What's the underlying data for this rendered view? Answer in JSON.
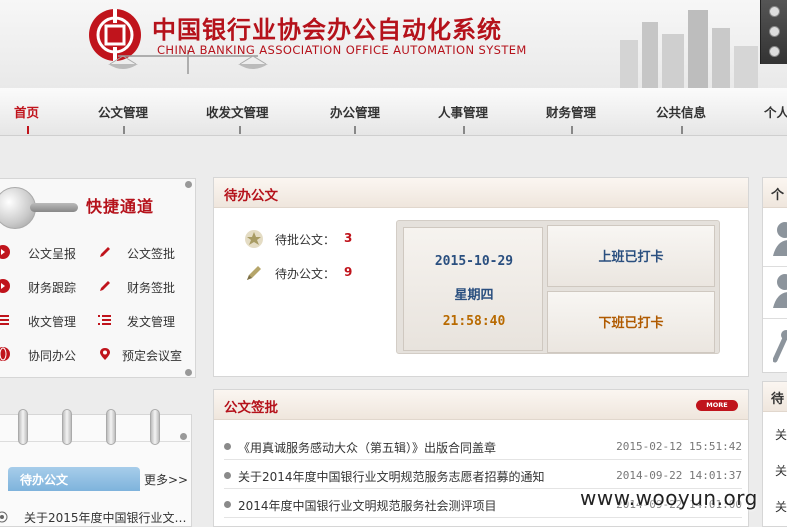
{
  "header": {
    "title_cn": "中国银行业协会办公自动化系统",
    "title_en": "CHINA BANKING ASSOCIATION  OFFICE AUTOMATION SYSTEM"
  },
  "nav": {
    "items": [
      "首页",
      "公文管理",
      "收发文管理",
      "办公管理",
      "人事管理",
      "财务管理",
      "公共信息",
      "个人"
    ],
    "active": "首页"
  },
  "quick": {
    "title": "快捷通道",
    "links": [
      {
        "label": "公文呈报",
        "icon": "arrow-right-icon"
      },
      {
        "label": "公文签批",
        "icon": "pen-icon"
      },
      {
        "label": "财务跟踪",
        "icon": "arrow-right-icon"
      },
      {
        "label": "财务签批",
        "icon": "pen-icon"
      },
      {
        "label": "收文管理",
        "icon": "list-icon"
      },
      {
        "label": "发文管理",
        "icon": "list-icon"
      },
      {
        "label": "协同办公",
        "icon": "globe-icon"
      },
      {
        "label": "预定会议室",
        "icon": "location-pin-icon"
      }
    ]
  },
  "todo_left": {
    "tab": "待办公文",
    "more": "更多>>",
    "item": "关于2015年度中国银行业文…"
  },
  "pending": {
    "title": "待办公文",
    "rows": [
      {
        "label": "待批公文：",
        "count": "3",
        "icon": "star-badge-icon"
      },
      {
        "label": "待办公文：",
        "count": "9",
        "icon": "pencil-icon"
      }
    ],
    "date": "2015-10-29",
    "weekday": "星期四",
    "time": "21:58:40",
    "clock_in": "上班已打卡",
    "clock_out": "下班已打卡"
  },
  "approval": {
    "title": "公文签批",
    "more": "MORE",
    "items": [
      {
        "title": "《用真诚服务感动大众（第五辑）》出版合同盖章",
        "time": "2015-02-12 15:51:42"
      },
      {
        "title": "关于2014年度中国银行业文明规范服务志愿者招募的通知",
        "time": "2014-09-22 14:01:37"
      },
      {
        "title": "2014年度中国银行业文明规范服务社会测评项目",
        "time": "2014-09-22 14:01:00"
      }
    ]
  },
  "right": {
    "panel1_title": "个",
    "panel2_title": "待",
    "rows": [
      "关",
      "关",
      "关"
    ]
  },
  "watermark": "www.wooyun.org",
  "colors": {
    "brand_red": "#b5121b",
    "clock_in_blue": "#2a4f7f",
    "clock_out_orange": "#b05a00",
    "time_orange": "#b86a00"
  }
}
